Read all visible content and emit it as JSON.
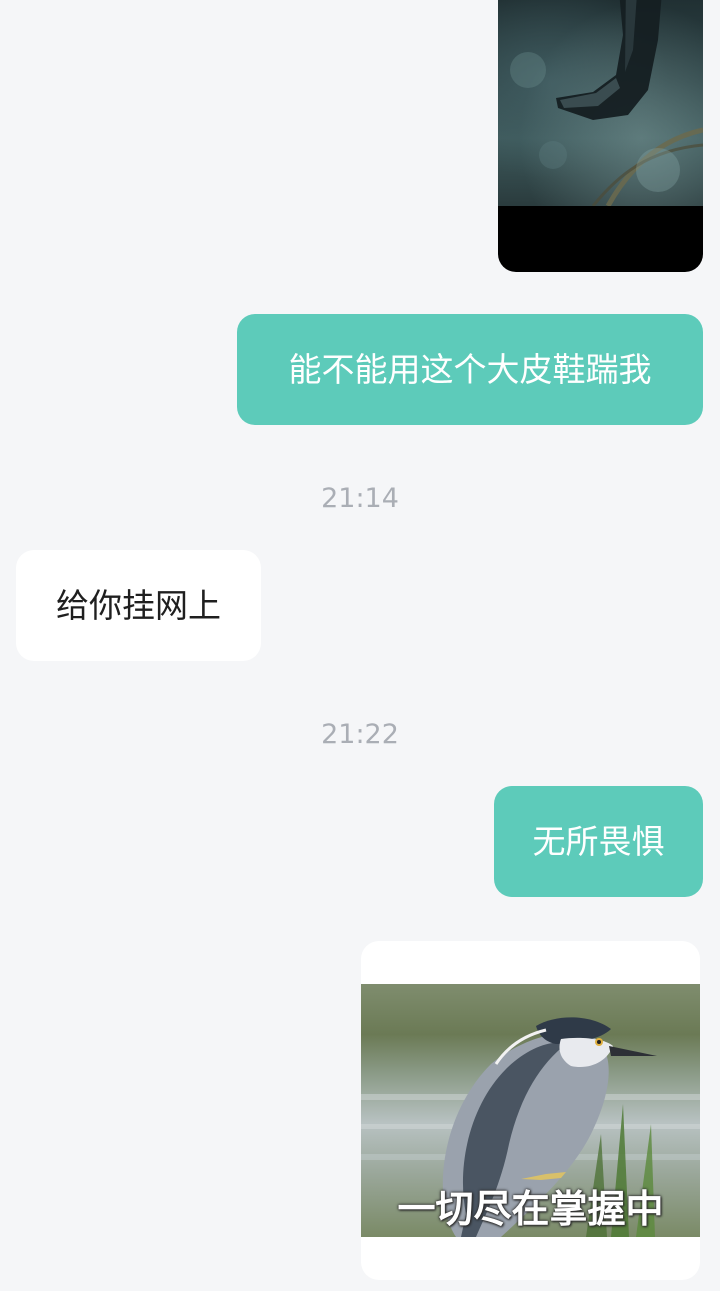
{
  "messages": {
    "sent_1": "能不能用这个大皮鞋踹我",
    "timestamp_1": "21:14",
    "received_1": "给你挂网上",
    "timestamp_2": "21:22",
    "sent_2": "无所畏惧",
    "sticker_caption": "一切尽在掌握中"
  },
  "colors": {
    "background": "#f5f6f8",
    "sent_bubble": "#5dcbba",
    "received_bubble": "#ffffff",
    "timestamp_text": "#aaaeb5"
  }
}
